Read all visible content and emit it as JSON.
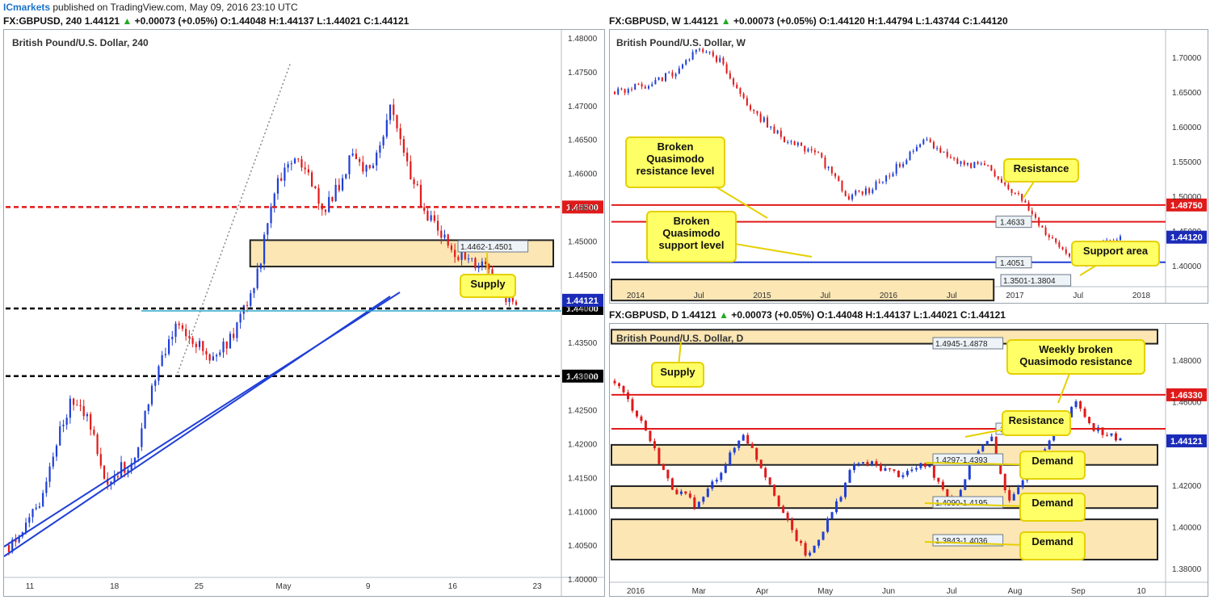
{
  "topbar": {
    "brand": "ICmarkets",
    "text": "published on TradingView.com, May 09, 2016 23:10 UTC"
  },
  "headers": {
    "h4": {
      "symbol": "FX:GBPUSD, 240",
      "last": "1.44121",
      "change": "+0.00073 (+0.05%)",
      "o": "O:1.44048",
      "h": "H:1.44137",
      "l": "L:1.44021",
      "c": "C:1.44121"
    },
    "w": {
      "symbol": "FX:GBPUSD, W",
      "last": "1.44121",
      "change": "+0.00073 (+0.05%)",
      "o": "O:1.44120",
      "h": "H:1.44794",
      "l": "L:1.43744",
      "c": "C:1.44120"
    },
    "d": {
      "symbol": "FX:GBPUSD, D",
      "last": "1.44121",
      "change": "+0.00073 (+0.05%)",
      "o": "O:1.44048",
      "h": "H:1.44137",
      "l": "L:1.44021",
      "c": "C:1.44121"
    }
  },
  "colors": {
    "bull": "#1f3fd6",
    "bear": "#e01a1a",
    "zone": "#fbe6b4",
    "callout": "#ffff66",
    "callout_border": "#e5d000",
    "resistance": "#e01a1a",
    "support_blue": "#1f3fd6"
  },
  "chart_data": [
    {
      "id": "h4",
      "type": "candlestick",
      "title": "British Pound/U.S. Dollar, 240",
      "ylim": [
        1.4,
        1.48
      ],
      "yticks": [
        "1.48000",
        "1.47500",
        "1.47000",
        "1.46500",
        "1.46000",
        "1.45500",
        "1.45000",
        "1.44500",
        "1.44000",
        "1.43500",
        "1.43000",
        "1.42500",
        "1.42000",
        "1.41500",
        "1.41000",
        "1.40500",
        "1.40000"
      ],
      "xticks": [
        "11",
        "18",
        "25",
        "May",
        "9",
        "16",
        "23"
      ],
      "last_price": "1.44121",
      "path": [
        [
          0,
          1.405
        ],
        [
          6,
          1.412
        ],
        [
          12,
          1.427
        ],
        [
          15,
          1.424
        ],
        [
          19,
          1.414
        ],
        [
          24,
          1.418
        ],
        [
          29,
          1.431
        ],
        [
          33,
          1.438
        ],
        [
          39,
          1.432
        ],
        [
          43,
          1.436
        ],
        [
          47,
          1.442
        ],
        [
          52,
          1.459
        ],
        [
          56,
          1.462
        ],
        [
          61,
          1.454
        ],
        [
          66,
          1.462
        ],
        [
          70,
          1.46
        ],
        [
          74,
          1.471
        ],
        [
          76,
          1.463
        ],
        [
          80,
          1.455
        ],
        [
          84,
          1.45
        ],
        [
          89,
          1.447
        ],
        [
          92,
          1.446
        ],
        [
          96,
          1.442
        ],
        [
          98,
          1.441
        ]
      ],
      "hlines": [
        {
          "price": 1.455,
          "label": "1.45500",
          "color": "#e01a1a",
          "dash": true
        },
        {
          "price": 1.44,
          "label": "1.44000",
          "color": "#000000",
          "dash": true
        },
        {
          "price": 1.43,
          "label": "1.43000",
          "color": "#000000",
          "dash": true
        }
      ],
      "zones": [
        {
          "top": 1.4501,
          "bottom": 1.4462,
          "label": "1.4462-1.4501",
          "from": 44,
          "to": 100
        }
      ],
      "annotations": [
        {
          "text": "Supply"
        }
      ]
    },
    {
      "id": "w",
      "type": "candlestick",
      "title": "British Pound/U.S. Dollar, W",
      "ylim": [
        1.37,
        1.73
      ],
      "yticks": [
        "1.70000",
        "1.65000",
        "1.60000",
        "1.55000",
        "1.50000",
        "1.45000",
        "1.40000"
      ],
      "xticks": [
        "2014",
        "Jul",
        "2015",
        "Jul",
        "2016",
        "Jul",
        "2017",
        "Jul",
        "2018"
      ],
      "last_price": "1.44120",
      "path": [
        [
          0,
          1.65
        ],
        [
          4,
          1.66
        ],
        [
          8,
          1.68
        ],
        [
          11,
          1.715
        ],
        [
          14,
          1.69
        ],
        [
          17,
          1.63
        ],
        [
          22,
          1.58
        ],
        [
          26,
          1.56
        ],
        [
          30,
          1.5
        ],
        [
          33,
          1.51
        ],
        [
          36,
          1.54
        ],
        [
          40,
          1.58
        ],
        [
          44,
          1.55
        ],
        [
          48,
          1.54
        ],
        [
          52,
          1.5
        ],
        [
          56,
          1.44
        ],
        [
          58,
          1.42
        ],
        [
          60,
          1.4
        ],
        [
          62,
          1.43
        ],
        [
          64,
          1.44
        ],
        [
          65,
          1.441
        ]
      ],
      "hlines": [
        {
          "price": 1.4875,
          "label": "1.48750",
          "color": "#e01a1a",
          "dash": false
        },
        {
          "price": 1.4633,
          "label": "1.4633",
          "color": "#e01a1a",
          "dash": false
        },
        {
          "price": 1.4051,
          "label": "1.4051",
          "color": "#1f3fd6",
          "dash": false
        }
      ],
      "zones": [
        {
          "top": 1.3804,
          "bottom": 1.3501,
          "label": "1.3501-1.3804",
          "from": 0,
          "to": 70
        }
      ],
      "annotations": [
        {
          "text": "Broken Quasimodo resistance level"
        },
        {
          "text": "Resistance"
        },
        {
          "text": "Broken Quasimodo support level"
        },
        {
          "text": "Support area"
        }
      ]
    },
    {
      "id": "d",
      "type": "candlestick",
      "title": "British Pound/U.S. Dollar, D",
      "ylim": [
        1.375,
        1.495
      ],
      "yticks": [
        "1.48000",
        "1.46000",
        "1.44000",
        "1.42000",
        "1.40000",
        "1.38000"
      ],
      "xticks": [
        "2016",
        "Mar",
        "Apr",
        "May",
        "Jun",
        "Jul",
        "Aug",
        "Sep",
        "10"
      ],
      "last_price": "1.44121",
      "path": [
        [
          0,
          1.47
        ],
        [
          3,
          1.45
        ],
        [
          6,
          1.42
        ],
        [
          9,
          1.41
        ],
        [
          12,
          1.43
        ],
        [
          14,
          1.445
        ],
        [
          17,
          1.42
        ],
        [
          19,
          1.4
        ],
        [
          21,
          1.385
        ],
        [
          24,
          1.41
        ],
        [
          26,
          1.43
        ],
        [
          28,
          1.43
        ],
        [
          31,
          1.425
        ],
        [
          34,
          1.43
        ],
        [
          37,
          1.41
        ],
        [
          39,
          1.435
        ],
        [
          41,
          1.442
        ],
        [
          43,
          1.41
        ],
        [
          45,
          1.43
        ],
        [
          48,
          1.445
        ],
        [
          50,
          1.46
        ],
        [
          52,
          1.448
        ],
        [
          55,
          1.441
        ]
      ],
      "hlines": [
        {
          "price": 1.4633,
          "label": "1.46330",
          "color": "#e01a1a",
          "dash": false
        },
        {
          "price": 1.447,
          "label": "1.4470",
          "color": "#e01a1a",
          "dash": false
        }
      ],
      "zones": [
        {
          "top": 1.4945,
          "bottom": 1.4878,
          "label": "1.4945-1.4878",
          "from": 0,
          "to": 100
        },
        {
          "top": 1.4393,
          "bottom": 1.4297,
          "label": "1.4297-1.4393",
          "from": 0,
          "to": 100
        },
        {
          "top": 1.4195,
          "bottom": 1.409,
          "label": "1.4090-1.4195",
          "from": 0,
          "to": 100
        },
        {
          "top": 1.4036,
          "bottom": 1.3843,
          "label": "1.3843-1.4036",
          "from": 0,
          "to": 100
        }
      ],
      "annotations": [
        {
          "text": "Supply"
        },
        {
          "text": "Weekly broken Quasimodo resistance"
        },
        {
          "text": "Resistance"
        },
        {
          "text": "Demand"
        },
        {
          "text": "Demand"
        },
        {
          "text": "Demand"
        }
      ]
    }
  ]
}
